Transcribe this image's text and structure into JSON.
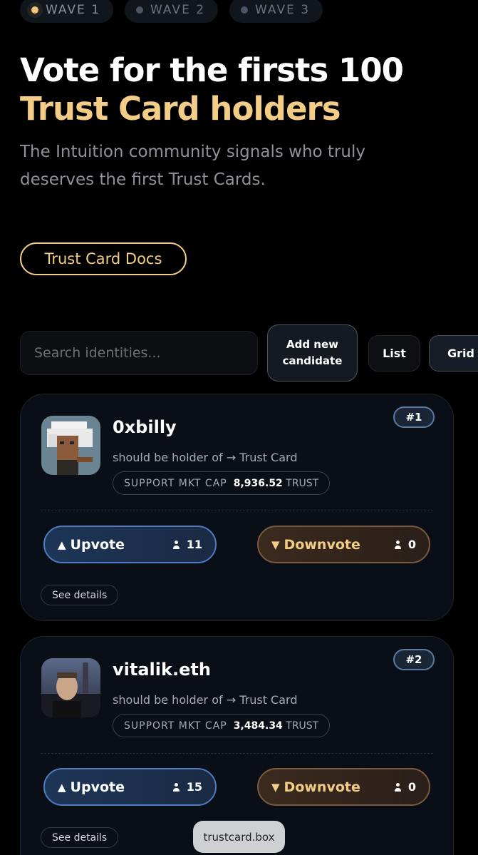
{
  "waves": [
    {
      "label": "WAVE 1",
      "active": true
    },
    {
      "label": "WAVE 2",
      "active": false
    },
    {
      "label": "WAVE 3",
      "active": false
    }
  ],
  "hero": {
    "title_main": "Vote for the firsts 100 ",
    "title_highlight": "Trust Card holders",
    "subtitle": "The Intuition community signals who truly deserves the first Trust Cards.",
    "docs_button": "Trust Card Docs"
  },
  "toolbar": {
    "search_placeholder": "Search identities...",
    "add_button": "Add new candidate",
    "list_button": "List",
    "grid_button": "Grid"
  },
  "candidates": [
    {
      "name": "0xbilly",
      "rank": "#1",
      "holder_text": "should be holder of → Trust Card",
      "mcap_label": "SUPPORT MKT CAP",
      "mcap_value": "8,936.52",
      "mcap_unit": "TRUST",
      "upvote_label": "Upvote",
      "upvote_count": "11",
      "downvote_label": "Downvote",
      "downvote_count": "0",
      "details_label": "See details"
    },
    {
      "name": "vitalik.eth",
      "rank": "#2",
      "holder_text": "should be holder of → Trust Card",
      "mcap_label": "SUPPORT MKT CAP",
      "mcap_value": "3,484.34",
      "mcap_unit": "TRUST",
      "upvote_label": "Upvote",
      "upvote_count": "15",
      "downvote_label": "Downvote",
      "downvote_count": "0",
      "details_label": "See details"
    }
  ],
  "toast": "trustcard.box",
  "colors": {
    "accent": "#f3cd86",
    "upvote_border": "#4e7cc0",
    "downvote_border": "#7a5a3e"
  }
}
